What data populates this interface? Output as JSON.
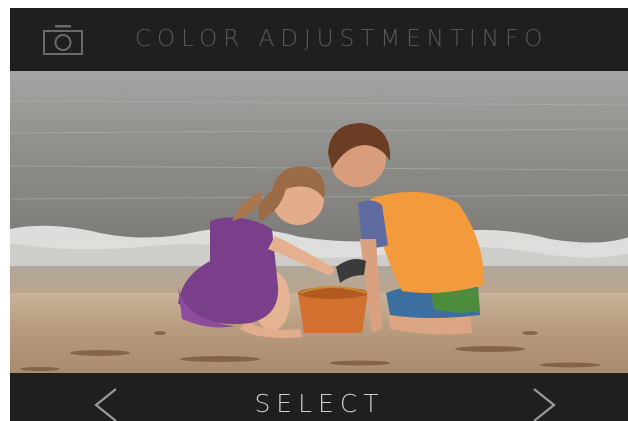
{
  "topbar": {
    "camera_icon": "camera-icon",
    "menu": [
      {
        "label": "COLOR ADJUSTMENT"
      },
      {
        "label": "INFO"
      }
    ]
  },
  "photo": {
    "subject": "children-at-beach"
  },
  "bottombar": {
    "prev_icon": "chevron-left-icon",
    "select_label": "SELECT",
    "next_icon": "chevron-right-icon"
  },
  "colors": {
    "bar_background": "#1f1f1f",
    "menu_text": "#595959",
    "select_text": "#cfcfcf"
  }
}
